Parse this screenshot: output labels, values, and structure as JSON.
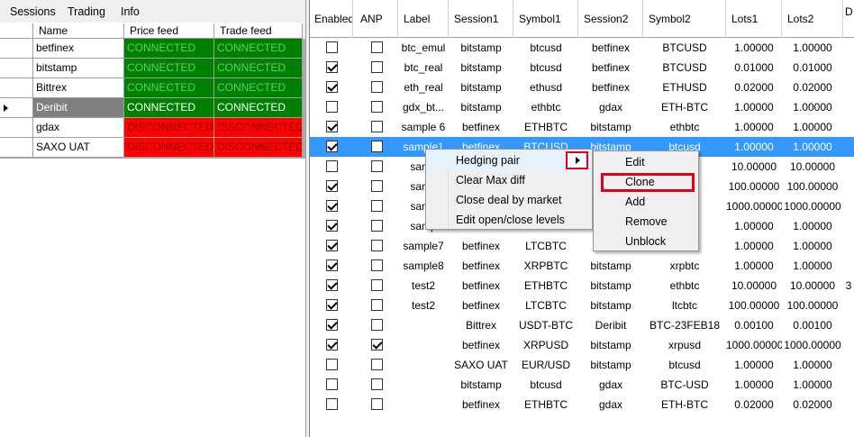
{
  "menubar": {
    "items": [
      "Sessions",
      "Trading",
      "Info"
    ]
  },
  "feeds": {
    "columns": [
      "Name",
      "Price feed",
      "Trade feed"
    ],
    "rows": [
      {
        "name": "betfinex",
        "price": "CONNECTED",
        "trade": "CONNECTED",
        "status": "connected"
      },
      {
        "name": "bitstamp",
        "price": "CONNECTED",
        "trade": "CONNECTED",
        "status": "connected"
      },
      {
        "name": "Bittrex",
        "price": "CONNECTED",
        "trade": "CONNECTED",
        "status": "connected"
      },
      {
        "name": "Deribit",
        "price": "CONNECTED",
        "trade": "CONNECTED",
        "status": "connected",
        "selected": true
      },
      {
        "name": "gdax",
        "price": "DISCONNECTED",
        "trade": "DISCONNECTED",
        "status": "disconnected"
      },
      {
        "name": "SAXO UAT",
        "price": "DISCONNECTED",
        "trade": "DISCONNECTED",
        "status": "disconnected"
      }
    ],
    "colors": {
      "connected": "#008000",
      "disconnected": "#ff0000"
    }
  },
  "pairs": {
    "columns": [
      "Enabled",
      "ANP",
      "Label",
      "Session1",
      "Symbol1",
      "Session2",
      "Symbol2",
      "Lots1",
      "Lots2",
      "D C"
    ],
    "rows": [
      {
        "enabled": false,
        "anp": false,
        "label": "btc_emul",
        "session1": "bitstamp",
        "symbol1": "btcusd",
        "session2": "betfinex",
        "symbol2": "BTCUSD",
        "lots1": "1.00000",
        "lots2": "1.00000",
        "extra": ""
      },
      {
        "enabled": true,
        "anp": false,
        "label": "btc_real",
        "session1": "bitstamp",
        "symbol1": "btcusd",
        "session2": "betfinex",
        "symbol2": "BTCUSD",
        "lots1": "0.01000",
        "lots2": "0.01000",
        "extra": ""
      },
      {
        "enabled": true,
        "anp": false,
        "label": "eth_real",
        "session1": "bitstamp",
        "symbol1": "ethusd",
        "session2": "betfinex",
        "symbol2": "ETHUSD",
        "lots1": "0.02000",
        "lots2": "0.02000",
        "extra": ""
      },
      {
        "enabled": false,
        "anp": false,
        "label": "gdx_bt...",
        "session1": "bitstamp",
        "symbol1": "ethbtc",
        "session2": "gdax",
        "symbol2": "ETH-BTC",
        "lots1": "1.00000",
        "lots2": "1.00000",
        "extra": ""
      },
      {
        "enabled": true,
        "anp": false,
        "label": "sample 6",
        "session1": "betfinex",
        "symbol1": "ETHBTC",
        "session2": "bitstamp",
        "symbol2": "ethbtc",
        "lots1": "1.00000",
        "lots2": "1.00000",
        "extra": ""
      },
      {
        "enabled": true,
        "anp": false,
        "label": "sample1",
        "session1": "betfinex",
        "symbol1": "BTCUSD",
        "session2": "bitstamp",
        "symbol2": "btcusd",
        "lots1": "1.00000",
        "lots2": "1.00000",
        "extra": "",
        "selected": true
      },
      {
        "enabled": false,
        "anp": false,
        "label": "samp",
        "session1": "",
        "symbol1": "",
        "session2": "",
        "symbol2": "",
        "lots1": "10.00000",
        "lots2": "10.00000",
        "extra": ""
      },
      {
        "enabled": true,
        "anp": false,
        "label": "samp",
        "session1": "",
        "symbol1": "",
        "session2": "",
        "symbol2": "",
        "lots1": "100.00000",
        "lots2": "100.00000",
        "extra": ""
      },
      {
        "enabled": true,
        "anp": false,
        "label": "samp",
        "session1": "",
        "symbol1": "",
        "session2": "",
        "symbol2": "",
        "lots1": "1000.00000",
        "lots2": "1000.00000",
        "extra": ""
      },
      {
        "enabled": true,
        "anp": false,
        "label": "samp",
        "session1": "",
        "symbol1": "",
        "session2": "",
        "symbol2": "",
        "lots1": "1.00000",
        "lots2": "1.00000",
        "extra": ""
      },
      {
        "enabled": true,
        "anp": false,
        "label": "sample7",
        "session1": "betfinex",
        "symbol1": "LTCBTC",
        "session2": "",
        "symbol2": "",
        "lots1": "1.00000",
        "lots2": "1.00000",
        "extra": ""
      },
      {
        "enabled": true,
        "anp": false,
        "label": "sample8",
        "session1": "betfinex",
        "symbol1": "XRPBTC",
        "session2": "bitstamp",
        "symbol2": "xrpbtc",
        "lots1": "1.00000",
        "lots2": "1.00000",
        "extra": ""
      },
      {
        "enabled": true,
        "anp": false,
        "label": "test2",
        "session1": "betfinex",
        "symbol1": "ETHBTC",
        "session2": "bitstamp",
        "symbol2": "ethbtc",
        "lots1": "10.00000",
        "lots2": "10.00000",
        "extra": "3"
      },
      {
        "enabled": true,
        "anp": false,
        "label": "test2",
        "session1": "betfinex",
        "symbol1": "LTCBTC",
        "session2": "bitstamp",
        "symbol2": "ltcbtc",
        "lots1": "100.00000",
        "lots2": "100.00000",
        "extra": ""
      },
      {
        "enabled": true,
        "anp": false,
        "label": "",
        "session1": "Bittrex",
        "symbol1": "USDT-BTC",
        "session2": "Deribit",
        "symbol2": "BTC-23FEB18",
        "lots1": "0.00100",
        "lots2": "0.00100",
        "extra": ""
      },
      {
        "enabled": true,
        "anp": true,
        "label": "",
        "session1": "betfinex",
        "symbol1": "XRPUSD",
        "session2": "bitstamp",
        "symbol2": "xrpusd",
        "lots1": "1000.00000",
        "lots2": "1000.00000",
        "extra": ""
      },
      {
        "enabled": false,
        "anp": false,
        "label": "",
        "session1": "SAXO UAT",
        "symbol1": "EUR/USD",
        "session2": "bitstamp",
        "symbol2": "btcusd",
        "lots1": "1.00000",
        "lots2": "1.00000",
        "extra": ""
      },
      {
        "enabled": false,
        "anp": false,
        "label": "",
        "session1": "bitstamp",
        "symbol1": "btcusd",
        "session2": "gdax",
        "symbol2": "BTC-USD",
        "lots1": "1.00000",
        "lots2": "1.00000",
        "extra": ""
      },
      {
        "enabled": false,
        "anp": false,
        "label": "",
        "session1": "betfinex",
        "symbol1": "ETHBTC",
        "session2": "gdax",
        "symbol2": "ETH-BTC",
        "lots1": "0.02000",
        "lots2": "0.02000",
        "extra": ""
      }
    ]
  },
  "context_menu": {
    "items": [
      "Hedging pair",
      "Clear Max diff",
      "Close deal by market",
      "Edit open/close levels"
    ],
    "highlight_color": "#e3001b"
  },
  "submenu": {
    "items": [
      "Edit",
      "Clone",
      "Add",
      "Remove",
      "Unblock"
    ],
    "highlighted": "Clone"
  }
}
